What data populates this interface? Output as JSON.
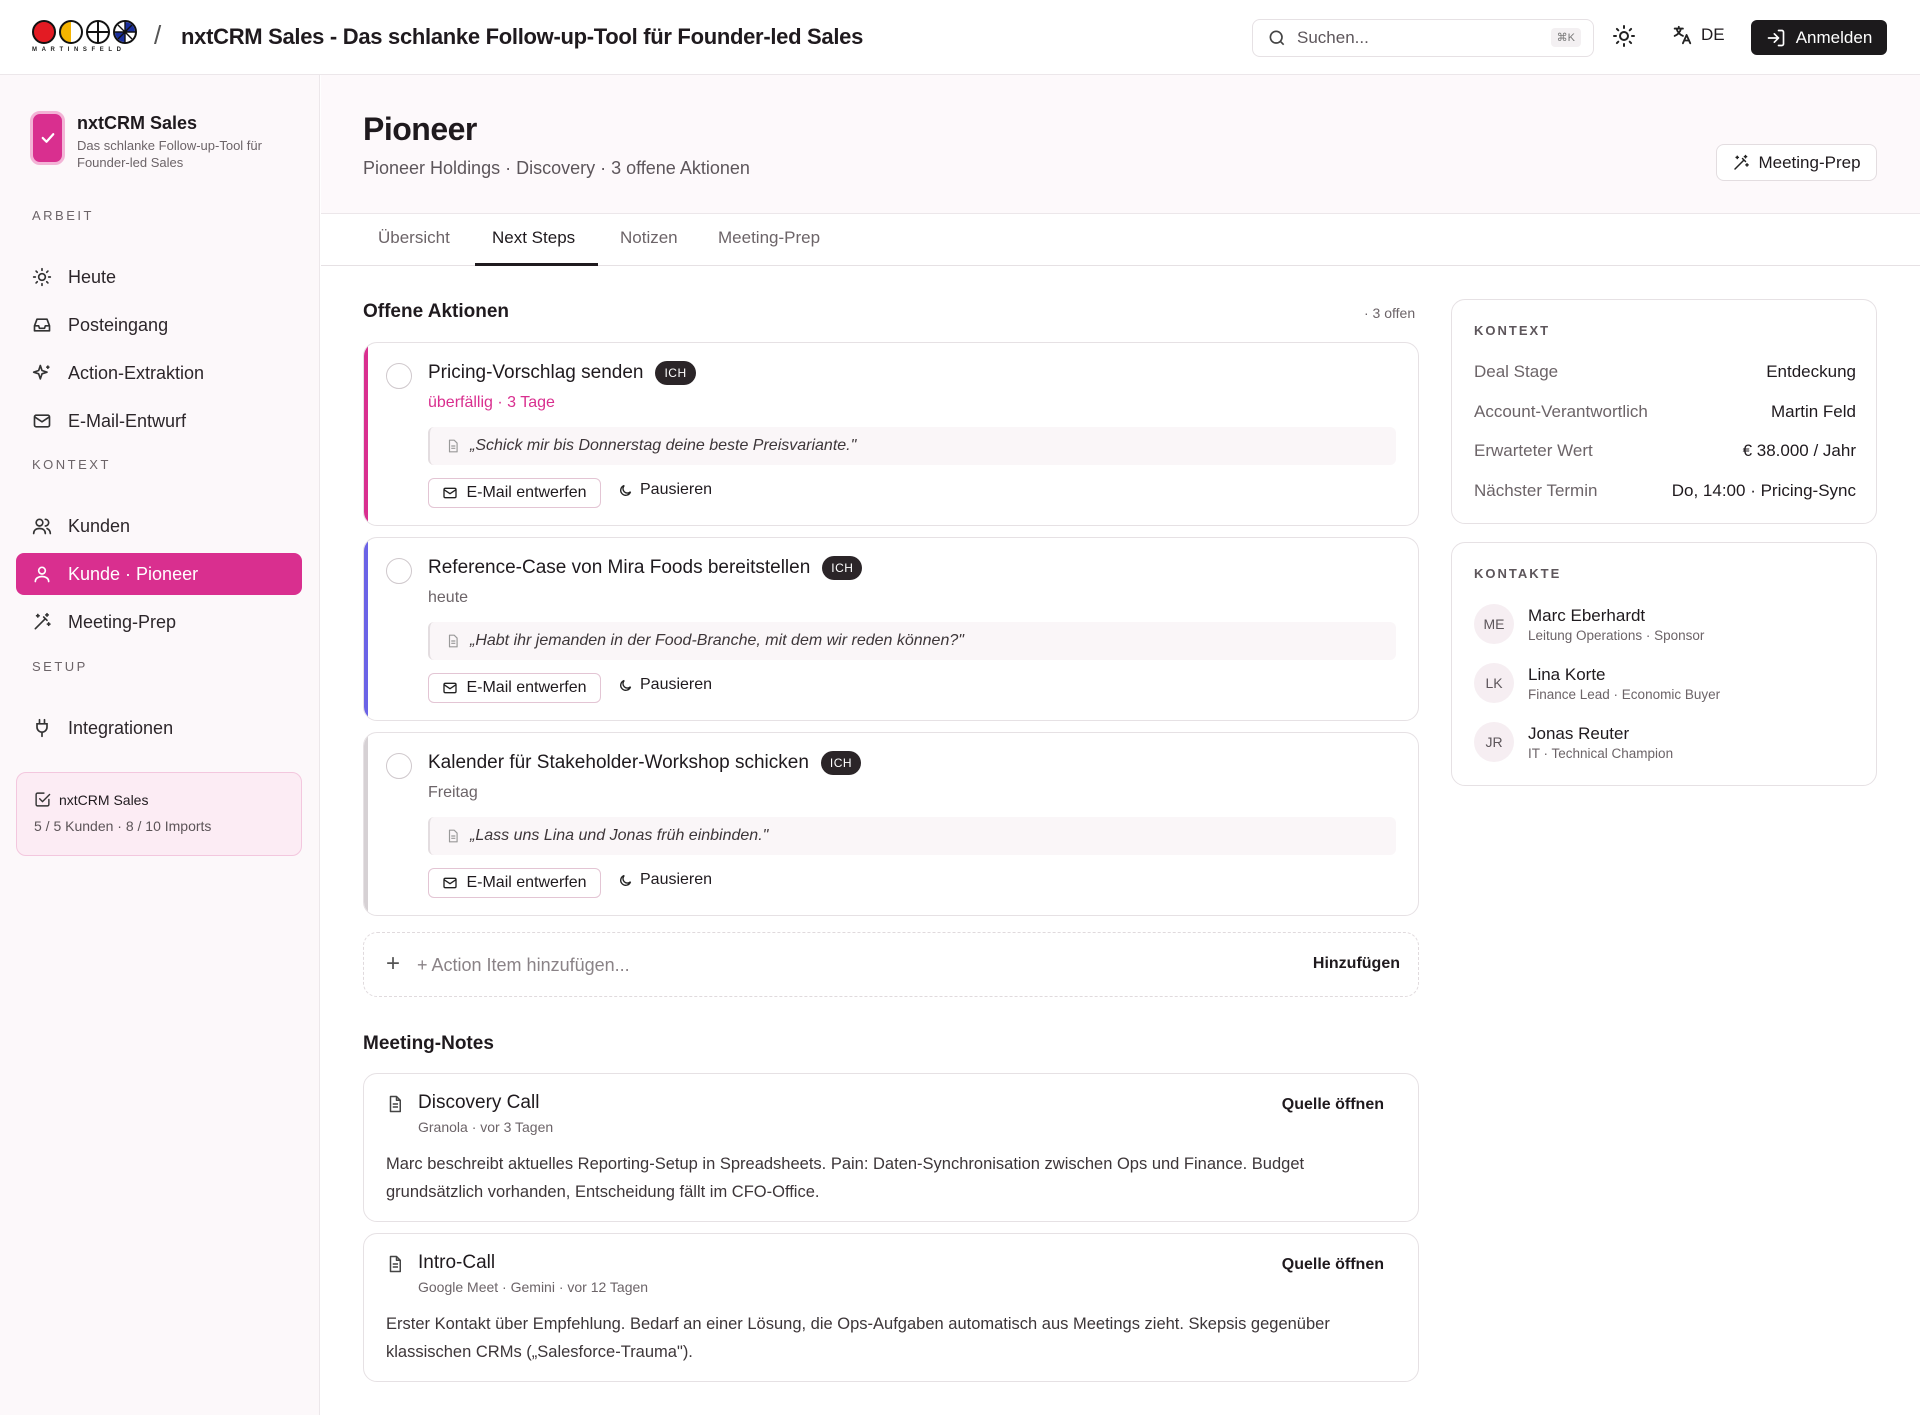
{
  "topbar": {
    "logo_word": "MARTINSFELD",
    "separator": "/",
    "title": "nxtCRM Sales - Das schlanke Follow-up-Tool für Founder-led Sales",
    "search_placeholder": "Suchen...",
    "search_shortcut": "⌘K",
    "lang": "DE",
    "login": "Anmelden"
  },
  "sidebar": {
    "brand_name": "nxtCRM Sales",
    "brand_sub": "Das schlanke Follow-up-Tool für Founder-led Sales",
    "sections": [
      "ARBEIT",
      "KONTEXT",
      "SETUP"
    ],
    "items": [
      {
        "label": "Heute",
        "icon": "sun-icon"
      },
      {
        "label": "Posteingang",
        "icon": "inbox-icon"
      },
      {
        "label": "Action-Extraktion",
        "icon": "sparkles-icon"
      },
      {
        "label": "E-Mail-Entwurf",
        "icon": "mail-icon"
      },
      {
        "label": "Kunden",
        "icon": "users-icon"
      },
      {
        "label": "Kunde · Pioneer",
        "icon": "user-icon",
        "active": true
      },
      {
        "label": "Meeting-Prep",
        "icon": "magic-wand-icon"
      },
      {
        "label": "Integrationen",
        "icon": "plug-icon"
      }
    ],
    "quota_title": "nxtCRM Sales",
    "quota_stats": "5 / 5 Kunden · 8 / 10 Imports"
  },
  "header": {
    "title": "Pioneer",
    "subtitle": "Pioneer Holdings · Discovery · 3 offene Aktionen",
    "prep_button": "Meeting-Prep"
  },
  "tabs": [
    "Übersicht",
    "Next Steps",
    "Notizen",
    "Meeting-Prep"
  ],
  "actions": {
    "title": "Offene Aktionen",
    "count": "· 3 offen",
    "items": [
      {
        "title": "Pricing-Vorschlag senden",
        "badge": "ICH",
        "due": "überfällig · 3 Tage",
        "quote": "„Schick mir bis Donnerstag deine beste Preisvariante.\"",
        "draft": "E-Mail entwerfen",
        "pause": "Pausieren",
        "color": "#d92f8f"
      },
      {
        "title": "Reference-Case von Mira Foods bereitstellen",
        "badge": "ICH",
        "due": "heute",
        "quote": "„Habt ihr jemanden in der Food-Branche, mit dem wir reden können?\"",
        "draft": "E-Mail entwerfen",
        "pause": "Pausieren",
        "color": "#6b63e6"
      },
      {
        "title": "Kalender für Stakeholder-Workshop schicken",
        "badge": "ICH",
        "due": "Freitag",
        "quote": "„Lass uns Lina und Jonas früh einbinden.\"",
        "draft": "E-Mail entwerfen",
        "pause": "Pausieren",
        "color": "#d6d1d4"
      }
    ],
    "add_placeholder": "+ Action Item hinzufügen...",
    "add_button": "Hinzufügen"
  },
  "notes": {
    "title": "Meeting-Notes",
    "items": [
      {
        "title": "Discovery Call",
        "meta": "Granola · vor 3 Tagen",
        "open": "Quelle öffnen",
        "body": "Marc beschreibt aktuelles Reporting-Setup in Spreadsheets. Pain: Daten-Synchronisation zwischen Ops und Finance. Budget grundsätzlich vorhanden, Entscheidung fällt im CFO-Office."
      },
      {
        "title": "Intro-Call",
        "meta": "Google Meet · Gemini · vor 12 Tagen",
        "open": "Quelle öffnen",
        "body": "Erster Kontakt über Empfehlung. Bedarf an einer Lösung, die Ops-Aufgaben automatisch aus Meetings zieht. Skepsis gegenüber klassischen CRMs („Salesforce-Trauma\")."
      }
    ]
  },
  "context": {
    "title": "KONTEXT",
    "rows": [
      {
        "k": "Deal Stage",
        "v": "Entdeckung"
      },
      {
        "k": "Account-Verantwortlich",
        "v": "Martin Feld"
      },
      {
        "k": "Erwarteter Wert",
        "v": "€ 38.000 / Jahr"
      },
      {
        "k": "Nächster Termin",
        "v": "Do, 14:00 · Pricing-Sync"
      }
    ]
  },
  "contacts": {
    "title": "KONTAKTE",
    "items": [
      {
        "initials": "ME",
        "name": "Marc Eberhardt",
        "role": "Leitung Operations · Sponsor"
      },
      {
        "initials": "LK",
        "name": "Lina Korte",
        "role": "Finance Lead · Economic Buyer"
      },
      {
        "initials": "JR",
        "name": "Jonas Reuter",
        "role": "IT · Technical Champion"
      }
    ]
  },
  "colors": {
    "accent": "#d92f8f",
    "dark": "#1c1a1c"
  }
}
